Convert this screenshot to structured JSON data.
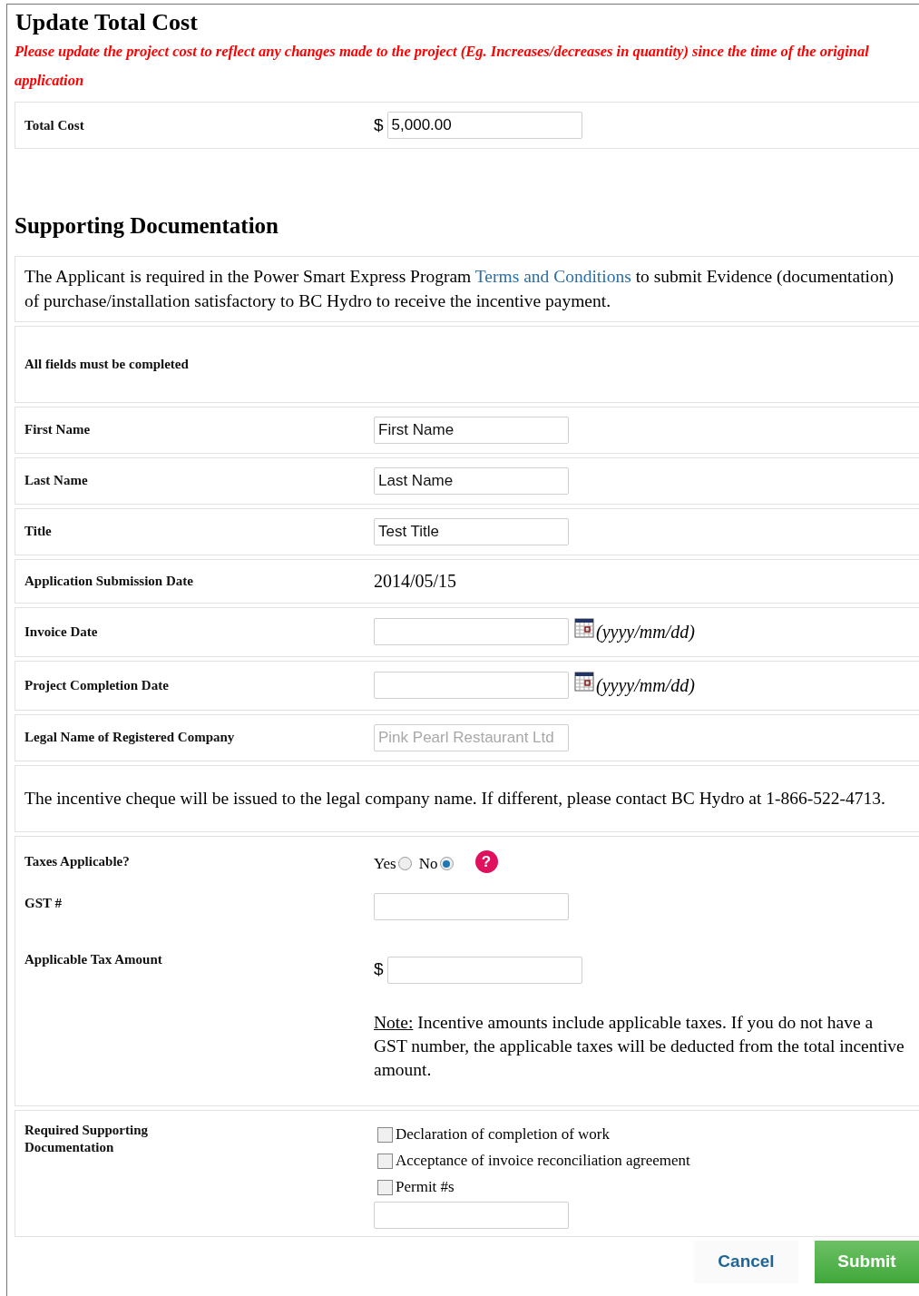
{
  "cost_section": {
    "title": "Update Total Cost",
    "instruction": "Please update the project cost to reflect any changes made to the project (Eg. Increases/decreases in quantity) since the time of the original application",
    "total_cost": {
      "label": "Total Cost",
      "currency": "$",
      "value": "5,000.00"
    }
  },
  "docs_section": {
    "title": "Supporting Documentation",
    "intro": {
      "before": "The Applicant is required in the Power Smart Express Program",
      "link": "Terms and Conditions",
      "after": "to submit Evidence (documentation) of purchase/installation satisfactory to BC Hydro to receive the incentive payment."
    },
    "required_note": "All fields must be completed",
    "fields": [
      {
        "kind": "input",
        "label": "First Name",
        "value": "First Name",
        "disabled": false
      },
      {
        "kind": "input",
        "label": "Last Name",
        "value": "Last Name",
        "disabled": false
      },
      {
        "kind": "input",
        "label": "Title",
        "value": "Test Title",
        "disabled": false
      },
      {
        "kind": "text",
        "label": "Application Submission Date",
        "value": "2014/05/15"
      },
      {
        "kind": "date",
        "label": "Invoice Date",
        "hint": "(yyyy/mm/dd)"
      },
      {
        "kind": "date",
        "label": "Project Completion Date",
        "hint": "(yyyy/mm/dd)"
      },
      {
        "kind": "input",
        "label": "Legal Name of Registered Company",
        "value": "Pink Pearl Restaurant Ltd",
        "disabled": true
      }
    ],
    "cheque_note": "The incentive cheque will be issued to the legal company name. If different, please contact BC Hydro at 1-866-522-4713.",
    "taxes": {
      "label": "Taxes Applicable?",
      "options": [
        {
          "label": "Yes",
          "selected": false
        },
        {
          "label": "No",
          "selected": true
        }
      ],
      "help": "?"
    },
    "gst": {
      "label": "GST #"
    },
    "tax_amount": {
      "label": "Applicable Tax Amount",
      "currency": "$"
    },
    "tax_note": {
      "lead": "Note:",
      "text": "Incentive amounts include applicable taxes. If you do not have a GST number, the applicable taxes will be deducted from the total incentive amount."
    },
    "required_docs": {
      "label": "Required Supporting Documentation",
      "items": [
        {
          "label": "Declaration of completion of work",
          "checked": false
        },
        {
          "label": "Acceptance of invoice reconciliation agreement",
          "checked": false
        },
        {
          "label": "Permit #s",
          "checked": false
        }
      ]
    }
  },
  "buttons": [
    {
      "kind": "secondary",
      "label": "Cancel"
    },
    {
      "kind": "primary",
      "label": "Submit"
    }
  ]
}
